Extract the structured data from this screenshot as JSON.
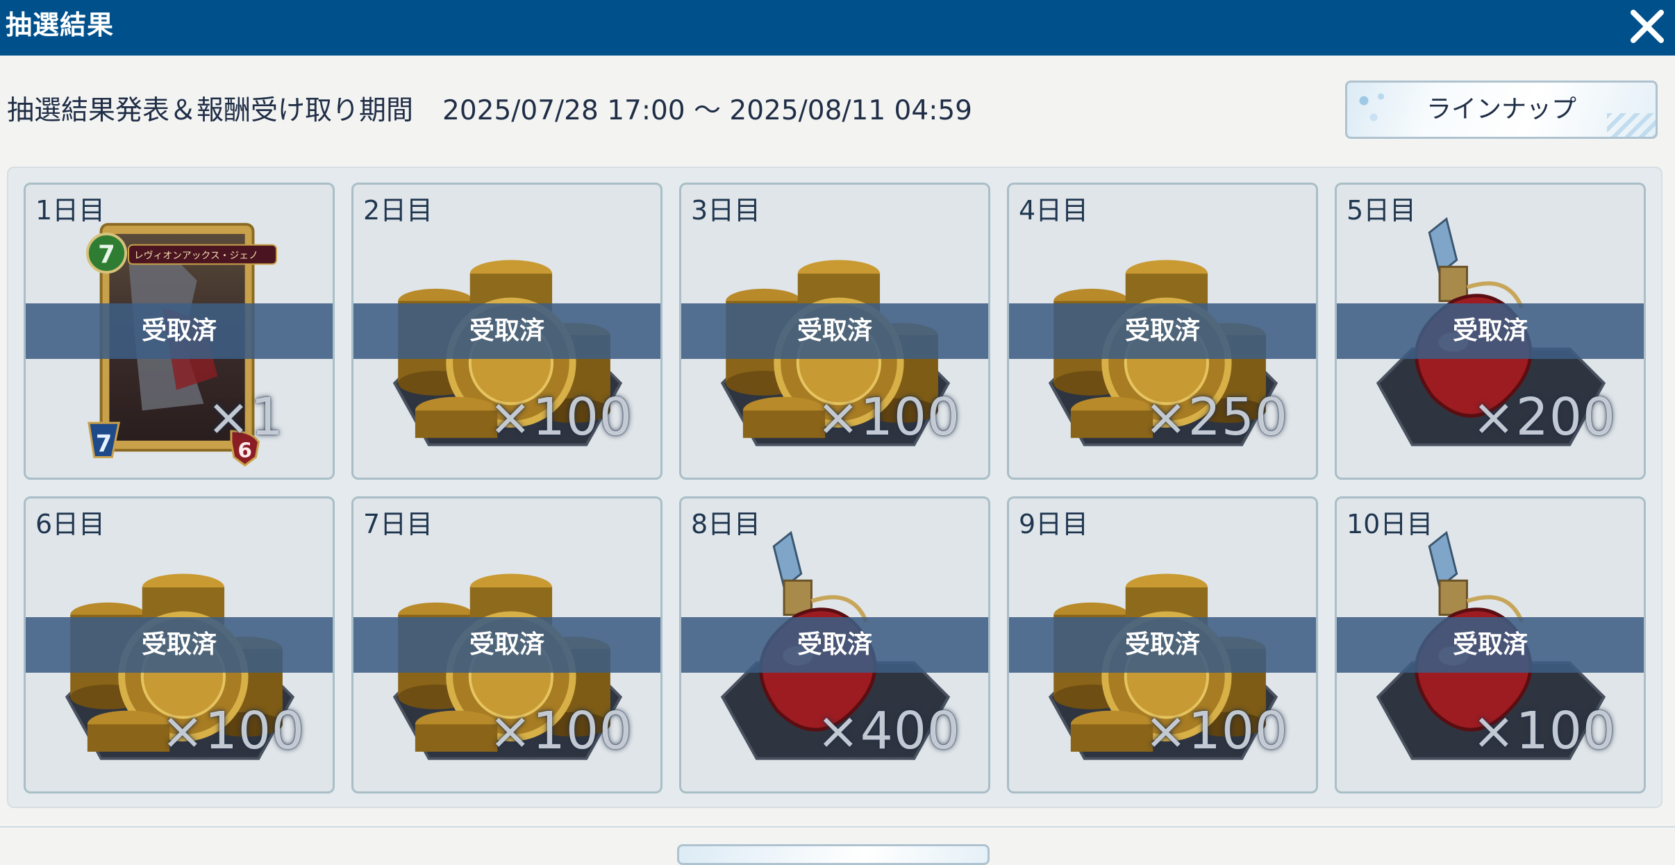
{
  "header": {
    "title": "抽選結果"
  },
  "period": {
    "label": "抽選結果発表＆報酬受け取り期間",
    "range": "2025/07/28 17:00 ～ 2025/08/11 04:59"
  },
  "lineup_button": {
    "label": "ラインナップ"
  },
  "rewards": [
    {
      "day": "1日目",
      "status": "受取済",
      "quantity": "×1",
      "item_icon": "card-icon",
      "card": {
        "name": "レヴィオンアックス・ジェノ",
        "cost": "7",
        "attack": "7",
        "defense": "6"
      }
    },
    {
      "day": "2日目",
      "status": "受取済",
      "quantity": "×100",
      "item_icon": "coin-stack-icon"
    },
    {
      "day": "3日目",
      "status": "受取済",
      "quantity": "×100",
      "item_icon": "coin-stack-icon"
    },
    {
      "day": "4日目",
      "status": "受取済",
      "quantity": "×250",
      "item_icon": "coin-stack-icon"
    },
    {
      "day": "5日目",
      "status": "受取済",
      "quantity": "×200",
      "item_icon": "potion-icon"
    },
    {
      "day": "6日目",
      "status": "受取済",
      "quantity": "×100",
      "item_icon": "coin-stack-icon"
    },
    {
      "day": "7日目",
      "status": "受取済",
      "quantity": "×100",
      "item_icon": "coin-stack-icon"
    },
    {
      "day": "8日目",
      "status": "受取済",
      "quantity": "×400",
      "item_icon": "potion-icon"
    },
    {
      "day": "9日目",
      "status": "受取済",
      "quantity": "×100",
      "item_icon": "coin-stack-icon"
    },
    {
      "day": "10日目",
      "status": "受取済",
      "quantity": "×100",
      "item_icon": "potion-icon"
    }
  ],
  "colors": {
    "header": "#00508c",
    "claimed_band": "#3e5d83",
    "tile_border": "#a9bec7"
  }
}
